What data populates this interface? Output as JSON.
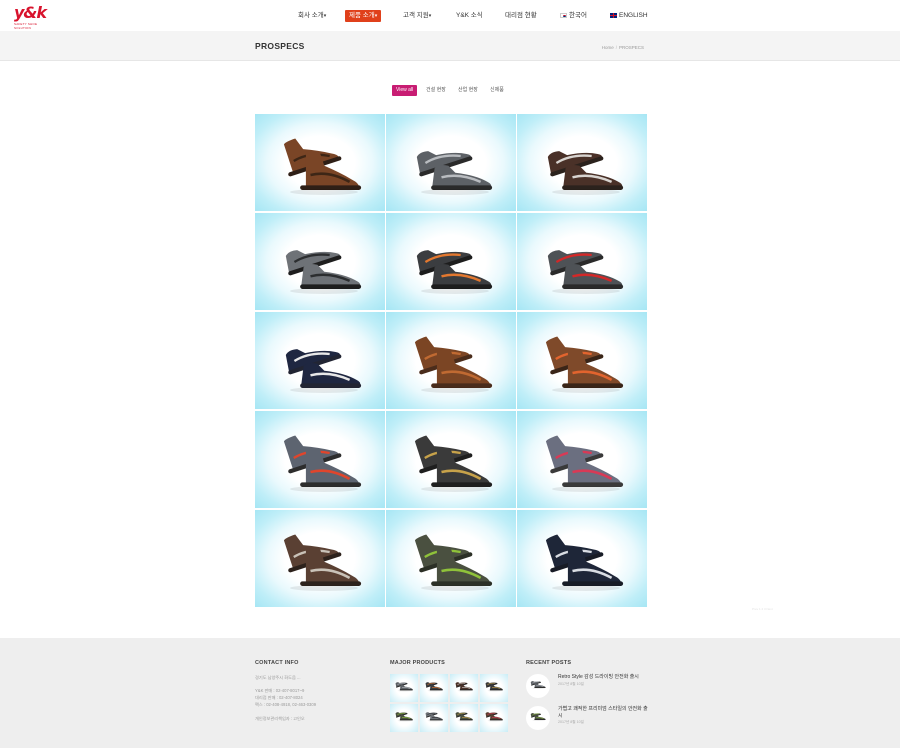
{
  "brand": {
    "logo_text": "y&k",
    "tagline": "SAFETY SHOE SOLUTION"
  },
  "nav": {
    "items": [
      {
        "label": "회사 소개",
        "caret": "▾"
      },
      {
        "label": "제품 소개",
        "caret": "▾",
        "active": true
      },
      {
        "label": "고객 지원",
        "caret": "▾"
      },
      {
        "label": "Y&K 소식",
        "caret": ""
      },
      {
        "label": "대리점 현황",
        "caret": ""
      }
    ],
    "lang_kr": "한국어",
    "lang_en": "ENGLISH"
  },
  "titlebar": {
    "title": "PROSPECS",
    "breadcrumb_home": "Home",
    "breadcrumb_sep": "/",
    "breadcrumb_current": "PROSPECS"
  },
  "filters": [
    {
      "label": "View all",
      "active": true
    },
    {
      "label": "건설 현장"
    },
    {
      "label": "산업 현장"
    },
    {
      "label": "신제품"
    }
  ],
  "products": [
    {
      "type": "boot",
      "upper": "#7a4526",
      "accent": "#3d2616",
      "sole": "#2e1f16"
    },
    {
      "type": "shoe",
      "upper": "#5d6166",
      "accent": "#b9bcc0",
      "sole": "#2a2a2a"
    },
    {
      "type": "shoe",
      "upper": "#4a3128",
      "accent": "#d8d4d0",
      "sole": "#2b221d"
    },
    {
      "type": "shoe",
      "upper": "#6e7277",
      "accent": "#2c2e30",
      "sole": "#1e1e1e"
    },
    {
      "type": "shoe",
      "upper": "#3b3d40",
      "accent": "#e3782f",
      "sole": "#1d1d1d"
    },
    {
      "type": "shoe",
      "upper": "#4e5256",
      "accent": "#d32828",
      "sole": "#2a2a2a"
    },
    {
      "type": "shoe",
      "upper": "#1f2741",
      "accent": "#e8e8e8",
      "sole": "#222533"
    },
    {
      "type": "boot",
      "upper": "#7b4524",
      "accent": "#c06a32",
      "sole": "#4a2c1b"
    },
    {
      "type": "boot",
      "upper": "#7f4a2a",
      "accent": "#e2642e",
      "sole": "#3a2518"
    },
    {
      "type": "boot",
      "upper": "#5d6470",
      "accent": "#e0452c",
      "sole": "#2d2d2d"
    },
    {
      "type": "boot",
      "upper": "#3a3a3a",
      "accent": "#c7a24a",
      "sole": "#1f1f1f"
    },
    {
      "type": "boot",
      "upper": "#6b6f80",
      "accent": "#d83a56",
      "sole": "#3a3a3a"
    },
    {
      "type": "boot",
      "upper": "#5a4033",
      "accent": "#c9c2b8",
      "sole": "#2d221c"
    },
    {
      "type": "boot",
      "upper": "#4a5040",
      "accent": "#8fc23a",
      "sole": "#2c3026"
    },
    {
      "type": "boot",
      "upper": "#1e2638",
      "accent": "#d9dde3",
      "sole": "#181c26"
    }
  ],
  "faint_text": "Prev  1 2 3  Next",
  "footer": {
    "contact": {
      "title": "CONTACT INFO",
      "address": "경기도 남양주시 화도읍 ...",
      "lines": [
        {
          "label": "Y&K 판매 :",
          "value": "02-407-8017~9"
        },
        {
          "label": "대리점 판매 :",
          "value": "02-407-8024"
        },
        {
          "label": "팩스 :",
          "value": "02-408-4918, 02-463-0309"
        }
      ],
      "manager": "개인정보관리책임자 : 고인오"
    },
    "major": {
      "title": "MAJOR PRODUCTS",
      "thumbs": [
        {
          "upper": "#5d6166",
          "accent": "#b9bcc0"
        },
        {
          "upper": "#3b3d40",
          "accent": "#e3782f"
        },
        {
          "upper": "#4a3128",
          "accent": "#d8d4d0"
        },
        {
          "upper": "#3a3a3a",
          "accent": "#c7a24a"
        },
        {
          "upper": "#4a5040",
          "accent": "#8fc23a"
        },
        {
          "upper": "#6e7277",
          "accent": "#2c2e30"
        },
        {
          "upper": "#4a5040",
          "accent": "#c7a24a"
        },
        {
          "upper": "#5a4033",
          "accent": "#d83a56"
        }
      ]
    },
    "recent": {
      "title": "RECENT POSTS",
      "posts": [
        {
          "title": "Retro Style 감성 드라이빙 안전화 출시",
          "date": "2017년 8월 10일",
          "upper": "#5d6166",
          "accent": "#b9bcc0"
        },
        {
          "title": "가볍고 쾌적한 프리미엄 스타일의 안전화 출시",
          "date": "2017년 8월 10일",
          "upper": "#4a5040",
          "accent": "#8fc23a"
        }
      ]
    }
  }
}
